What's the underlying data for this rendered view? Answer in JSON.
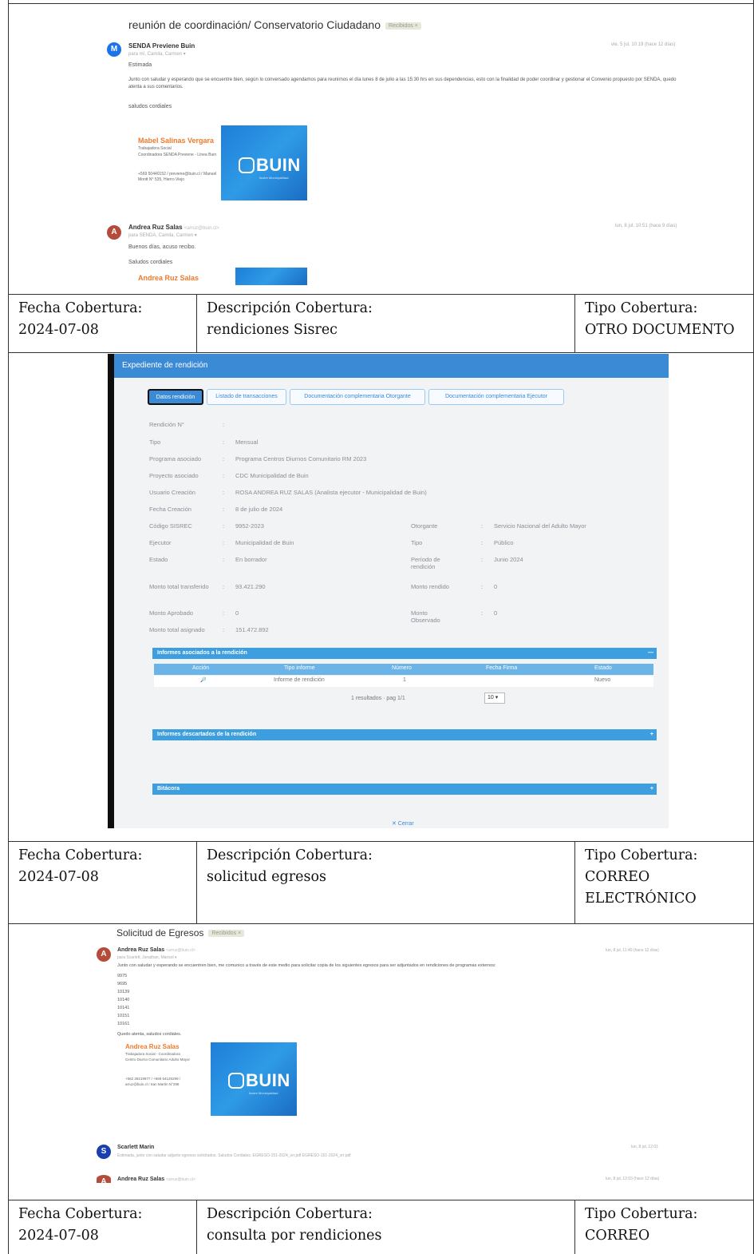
{
  "email1": {
    "subject": "reunión de coordinación/ Conservatorio Ciudadano",
    "subject_tag": "Recibidos ×",
    "messages": [
      {
        "avatar": "M",
        "sender": "SENDA Previene Buin",
        "to": "para mí, Camila, Carmen ▾",
        "date": "vie, 5 jul, 10:19 (hace 12 días)",
        "greeting": "Estimada",
        "body": "Junto con saludar y esperando que se encuentre bien, según lo conversado agendamos para reunirnos el día lunes 8 de julio a las 15:30 hrs en sus dependencias, esto con la finalidad de poder coordinar y gestionar el Convenio propuesto por SENDA, quedo atenta a sus comentarios.",
        "closing": "saludos cordiales",
        "signature": {
          "name": "Mabel Salinas Vergara",
          "role": "Trabajadora Social",
          "org": "Coordinadora SENDA Previene - Línea Buin",
          "contact": "+569 50440152 / previene@buin.cl / Manuel Montt N° 535, Hierro Viejo"
        }
      },
      {
        "avatar": "A",
        "sender": "Andrea Ruz Salas",
        "sender_extra": "<arruz@buin.cl>",
        "to": "para SENDA, Camila, Carmen ▾",
        "date": "lun, 8 jul, 10:51 (hace 9 días)",
        "greeting": "Buenos días, acuso recibo.",
        "closing": "Saludos cordiales",
        "signature_name": "Andrea Ruz Salas"
      }
    ]
  },
  "row1": {
    "fecha_label": "Fecha Cobertura:",
    "fecha_value": "2024-07-08",
    "descripcion_label": "Descripción Cobertura:",
    "descripcion_value": "rendiciones Sisrec",
    "tipo_label": "Tipo Cobertura:",
    "tipo_value": "OTRO DOCUMENTO"
  },
  "sisrec": {
    "window_title": "Expediente de rendición",
    "tabs": [
      "Datos rendición",
      "Listado de transacciones",
      "Documentación complementaria Otorgante",
      "Documentación complementaria Ejecutor"
    ],
    "fields_left": [
      {
        "label": "Rendición N°",
        "value": ""
      },
      {
        "label": "Tipo",
        "value": "Mensual"
      },
      {
        "label": "Programa asociado",
        "value": "Programa Centros Diurnos Comunitario RM 2023"
      },
      {
        "label": "Proyecto asociado",
        "value": "CDC Municipalidad de Buin"
      },
      {
        "label": "Usuario Creación",
        "value": "ROSA ANDREA RUZ SALAS (Analista ejecutor - Municipalidad de Buin)"
      },
      {
        "label": "Fecha Creación",
        "value": "8 de julio de 2024"
      },
      {
        "label": "Código SISREC",
        "value": "9952-2023"
      },
      {
        "label": "Ejecutor",
        "value": "Municipalidad de Buin"
      },
      {
        "label": "Estado",
        "value": "En borrador"
      },
      {
        "label": "Monto total transferido",
        "value": "93.421.290"
      },
      {
        "label": "Monto Aprobado",
        "value": "0"
      },
      {
        "label": "Monto total asignado",
        "value": "151.472.892"
      }
    ],
    "fields_right": [
      {
        "label": "Otorgante",
        "value": "Servicio Nacional del Adulto Mayor"
      },
      {
        "label": "Tipo",
        "value": "Público"
      },
      {
        "label": "Período de rendición",
        "value": "Junio 2024"
      },
      {
        "label": "Monto rendido",
        "value": "0"
      },
      {
        "label": "Monto Observado",
        "value": "0"
      }
    ],
    "panel_informes": "Informes asociados a la rendición",
    "grid_headers": [
      "Acción",
      "Tipo informe",
      "Número",
      "Fecha Firma",
      "Estado"
    ],
    "grid_row": [
      "🔎",
      "Informe de rendición",
      "1",
      "",
      "Nuevo"
    ],
    "pager_text": "1 resultados · pag 1/1",
    "pager_size": "10",
    "panel_descartados": "Informes descartados de la rendición",
    "panel_bitacora": "Bitácora",
    "close_label": "✕ Cerrar"
  },
  "row2": {
    "fecha_label": "Fecha Cobertura:",
    "fecha_value": "2024-07-08",
    "descripcion_label": "Descripción Cobertura:",
    "descripcion_value": "solicitud egresos",
    "tipo_label": "Tipo Cobertura:",
    "tipo_value_1": "CORREO",
    "tipo_value_2": "ELECTRÓNICO"
  },
  "email2": {
    "subject": "Solicitud de Egresos",
    "subject_tag": "Recibidos ×",
    "messages": [
      {
        "avatar": "A",
        "sender": "Andrea Ruz Salas",
        "sender_extra": "<arruz@buin.cl>",
        "to": "para Scarlett, Jonathan, Marisol ▾",
        "date": "lun, 8 jul, 11:40 (hace 12 días)",
        "body": "Junto con saludar y esperando se encuentren bien, me comunico a través de este medio para solicitar copia de los siguientes egresos para ser adjuntados en rendiciones de programas externos:",
        "list": [
          "9975",
          "9695",
          "10139",
          "10140",
          "10141",
          "10151",
          "10161"
        ],
        "closing": "Quedo atenta, saludos cordiales.",
        "signature": {
          "name": "Andrea Ruz Salas",
          "role": "Trabajadora Social - Coordinadora",
          "org": "Centro Diurno Comunitario Adulto Mayor",
          "contact": "+562 28219977 / +569 64125299 / arruz@buin.cl / San Martín N°299"
        }
      },
      {
        "avatar": "S",
        "sender": "Scarlett Marin",
        "date": "lun, 8 jul, 12:01",
        "body": "Estimada, junto con saludar adjunto egresos solicitados. Saludos Cordiales. EGRESO-151-2024_vrr.pdf EGRESO-151-2024_vrr.pdf"
      },
      {
        "avatar": "A",
        "sender": "Andrea Ruz Salas",
        "sender_extra": "<arruz@buin.cl>",
        "date": "lun, 8 jul, 12:03 (hace 12 días)"
      }
    ]
  },
  "logo": {
    "word": "BUIN",
    "tagline": "Ilustre Municipalidad"
  },
  "row3": {
    "fecha_label": "Fecha Cobertura:",
    "fecha_value": "2024-07-08",
    "descripcion_label": "Descripción Cobertura:",
    "descripcion_value": "consulta por rendiciones",
    "tipo_label": "Tipo Cobertura:",
    "tipo_value": "CORREO"
  }
}
